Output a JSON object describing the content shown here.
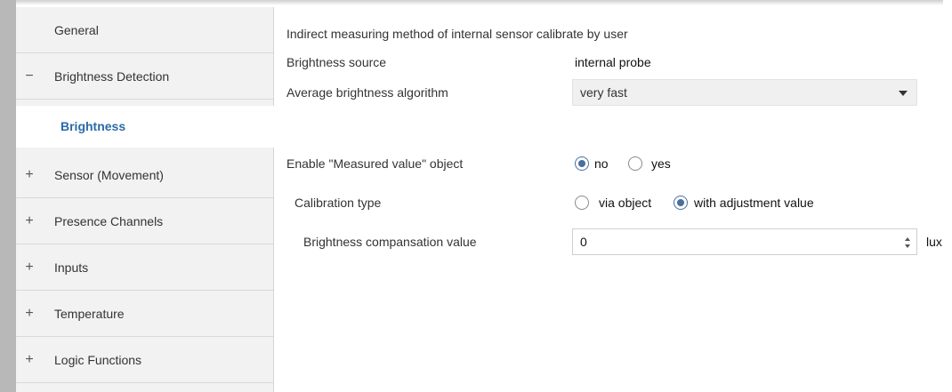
{
  "sidebar": {
    "items": [
      {
        "label": "General",
        "prefix": ""
      },
      {
        "label": "Brightness Detection",
        "prefix": "−"
      },
      {
        "label": "Brightness",
        "prefix": ""
      },
      {
        "label": "Sensor (Movement)",
        "prefix": "+"
      },
      {
        "label": "Presence Channels",
        "prefix": "+"
      },
      {
        "label": "Inputs",
        "prefix": "+"
      },
      {
        "label": "Temperature",
        "prefix": "+"
      },
      {
        "label": "Logic Functions",
        "prefix": "+"
      }
    ]
  },
  "main": {
    "heading": "Indirect measuring method of internal sensor calibrate by user",
    "brightness_source": {
      "label": "Brightness source",
      "value": "internal probe"
    },
    "average_algorithm": {
      "label": "Average brightness algorithm",
      "value": "very fast"
    },
    "measured_value_object": {
      "label": "Enable \"Measured value\" object",
      "options": [
        "no",
        "yes"
      ],
      "selected": "no"
    },
    "calibration_type": {
      "label": "Calibration type",
      "options": [
        "via object",
        "with adjustment value"
      ],
      "selected": "with adjustment value"
    },
    "compensation": {
      "label": "Brightness compansation value",
      "value": "0",
      "unit": "lux"
    }
  },
  "colors": {
    "accent": "#2d6aa8",
    "radio_selected": "#4a6ea0",
    "sidebar_bg": "#f2f2f2"
  }
}
